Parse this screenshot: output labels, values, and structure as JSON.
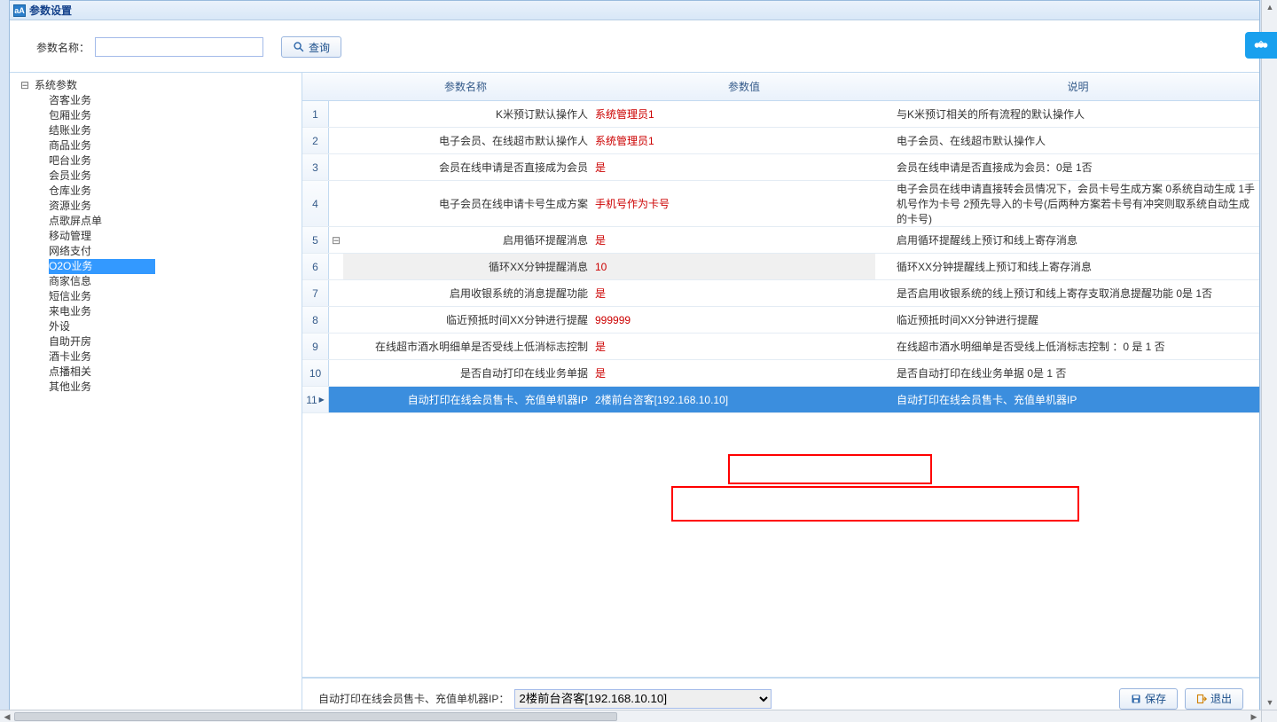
{
  "title": "参数设置",
  "toolbar": {
    "param_name_label": "参数名称：",
    "search_label": "查询"
  },
  "tree": {
    "root": "系统参数",
    "children": [
      "咨客业务",
      "包厢业务",
      "结账业务",
      "商品业务",
      "吧台业务",
      "会员业务",
      "仓库业务",
      "资源业务",
      "点歌屏点单",
      "移动管理",
      "网络支付",
      "O2O业务",
      "商家信息",
      "短信业务",
      "来电业务",
      "外设",
      "自助开房",
      "酒卡业务",
      "点播相关",
      "其他业务"
    ],
    "selected_index": 11
  },
  "grid": {
    "headers": {
      "name": "参数名称",
      "value": "参数值",
      "desc": "说明"
    },
    "rows": [
      {
        "n": "1",
        "name": "K米预订默认操作人",
        "value": "系统管理员1",
        "desc": "与K米预订相关的所有流程的默认操作人"
      },
      {
        "n": "2",
        "name": "电子会员、在线超市默认操作人",
        "value": "系统管理员1",
        "desc": "电子会员、在线超市默认操作人"
      },
      {
        "n": "3",
        "name": "会员在线申请是否直接成为会员",
        "value": "是",
        "desc": "会员在线申请是否直接成为会员：0是 1否"
      },
      {
        "n": "4",
        "name": "电子会员在线申请卡号生成方案",
        "value": "手机号作为卡号",
        "desc": "电子会员在线申请直接转会员情况下，会员卡号生成方案 0系统自动生成 1手机号作为卡号 2预先导入的卡号(后两种方案若卡号有冲突则取系统自动生成的卡号)"
      },
      {
        "n": "5",
        "name": "启用循环提醒消息",
        "value": "是",
        "desc": "启用循环提醒线上预订和线上寄存消息",
        "expander": "⊟"
      },
      {
        "n": "6",
        "name": "循环XX分钟提醒消息",
        "value": "10",
        "desc": "循环XX分钟提醒线上预订和线上寄存消息",
        "indented": true
      },
      {
        "n": "7",
        "name": "启用收银系统的消息提醒功能",
        "value": "是",
        "desc": "是否启用收银系统的线上预订和线上寄存支取消息提醒功能 0是 1否"
      },
      {
        "n": "8",
        "name": "临近预抵时间XX分钟进行提醒",
        "value": "999999",
        "desc": "临近预抵时间XX分钟进行提醒"
      },
      {
        "n": "9",
        "name": "在线超市酒水明细单是否受线上低消标志控制",
        "value": "是",
        "desc": "在线超市酒水明细单是否受线上低消标志控制 ：0 是 1 否"
      },
      {
        "n": "10",
        "name": "是否自动打印在线业务单据",
        "value": "是",
        "desc": "是否自动打印在线业务单据 0是 1 否"
      },
      {
        "n": "11",
        "name": "自动打印在线会员售卡、充值单机器IP",
        "value": "2楼前台咨客[192.168.10.10]",
        "desc": "自动打印在线会员售卡、充值单机器IP",
        "selected": true
      }
    ]
  },
  "footer": {
    "field_label": "自动打印在线会员售卡、充值单机器IP：",
    "select_value": "2楼前台咨客[192.168.10.10]",
    "save_label": "保存",
    "exit_label": "退出"
  }
}
